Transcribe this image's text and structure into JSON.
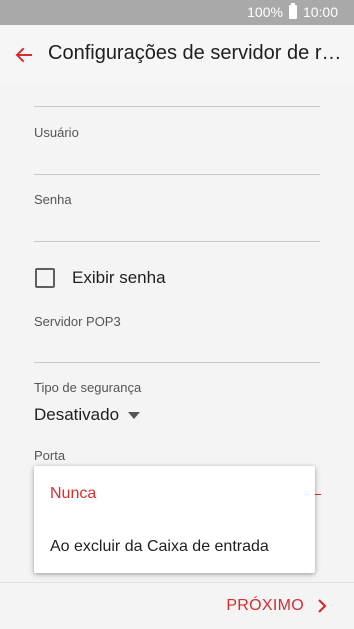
{
  "status_bar": {
    "battery": "100%",
    "time": "10:00"
  },
  "app_bar": {
    "title": "Configurações de servidor de recebimento"
  },
  "form": {
    "username_label": "Usuário",
    "password_label": "Senha",
    "show_password_label": "Exibir senha",
    "show_password_checked": false,
    "pop3_server_label": "Servidor POP3",
    "security_type_label": "Tipo de segurança",
    "security_type_value": "Desativado",
    "port_label": "Porta"
  },
  "popup_menu": {
    "options": [
      {
        "label": "Nunca",
        "selected": true
      },
      {
        "label": "Ao excluir da Caixa de entrada",
        "selected": false
      }
    ]
  },
  "bottom_bar": {
    "next_label": "PRÓXIMO"
  },
  "colors": {
    "accent": "#d32f2f",
    "status_bar": "#a9a9a9",
    "background": "#f4f4f4"
  },
  "icons": [
    "battery-icon",
    "back-arrow-icon",
    "checkbox-icon",
    "dropdown-caret-icon",
    "chevron-right-icon"
  ]
}
